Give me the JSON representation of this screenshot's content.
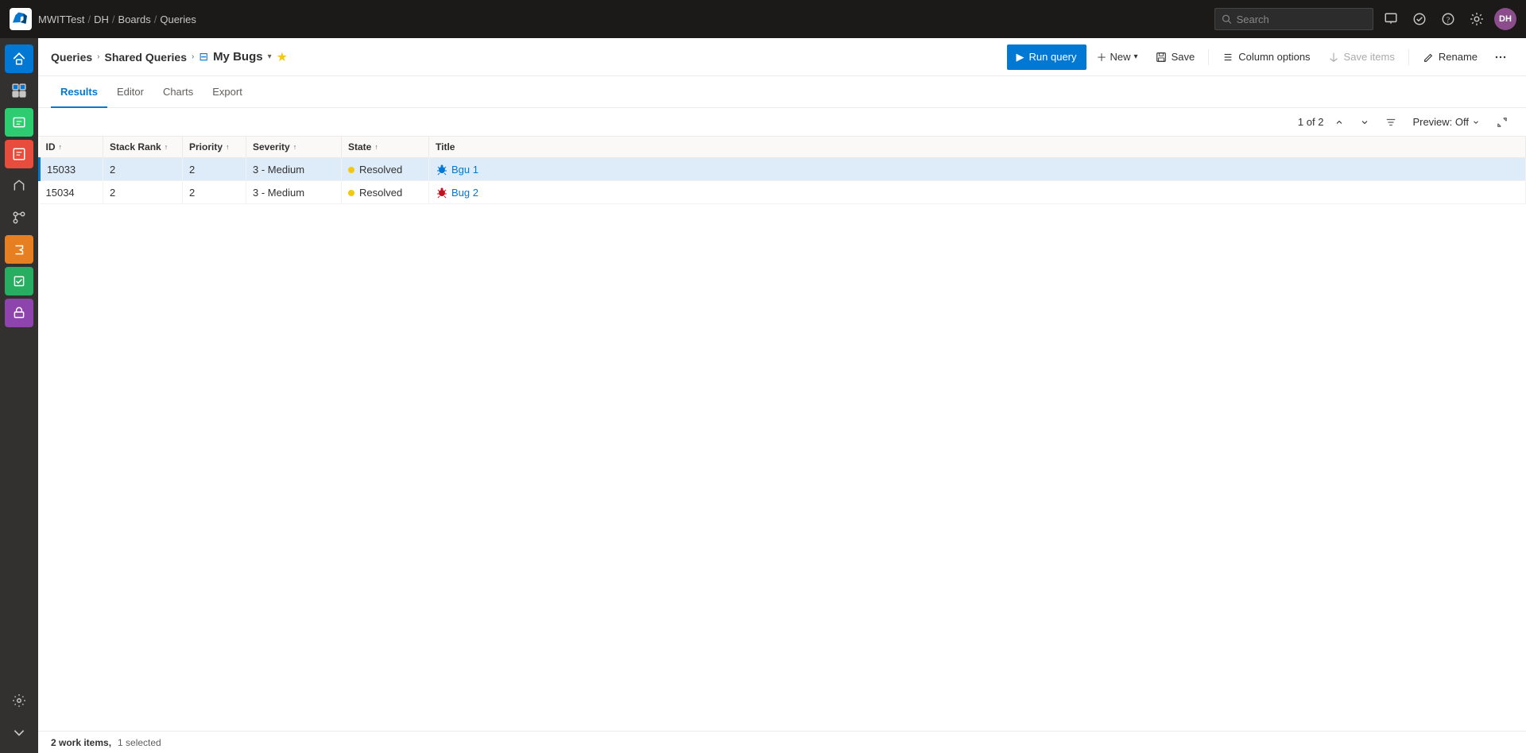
{
  "topbar": {
    "logo_label": "Azure DevOps",
    "breadcrumb": [
      "MWITTest",
      "DH",
      "Boards",
      "Queries"
    ],
    "search_placeholder": "Search"
  },
  "page": {
    "breadcrumb_queries": "Queries",
    "breadcrumb_shared": "Shared Queries",
    "query_title": "My Bugs",
    "run_query_label": "Run query",
    "new_label": "New",
    "save_label": "Save",
    "column_options_label": "Column options",
    "save_items_label": "Save items",
    "rename_label": "Rename"
  },
  "tabs": [
    {
      "label": "Results",
      "active": true
    },
    {
      "label": "Editor",
      "active": false
    },
    {
      "label": "Charts",
      "active": false
    },
    {
      "label": "Export",
      "active": false
    }
  ],
  "pagination": {
    "text": "1 of 2"
  },
  "preview": {
    "label": "Preview: Off"
  },
  "columns": [
    {
      "label": "ID",
      "sort": "↑"
    },
    {
      "label": "Stack Rank",
      "sort": "↑"
    },
    {
      "label": "Priority",
      "sort": "↑"
    },
    {
      "label": "Severity",
      "sort": "↑"
    },
    {
      "label": "State",
      "sort": "↑"
    },
    {
      "label": "Title",
      "sort": ""
    }
  ],
  "rows": [
    {
      "id": "15033",
      "stack_rank": "2",
      "priority": "2",
      "severity": "3 - Medium",
      "state": "Resolved",
      "title": "Bgu 1",
      "selected": true,
      "bug_color": "blue"
    },
    {
      "id": "15034",
      "stack_rank": "2",
      "priority": "2",
      "severity": "3 - Medium",
      "state": "Resolved",
      "title": "Bug 2",
      "selected": false,
      "bug_color": "red"
    }
  ],
  "statusbar": {
    "count_text": "2 work items,",
    "selected_text": "1 selected"
  },
  "sidebar": {
    "items": [
      {
        "name": "home",
        "symbol": "⌂",
        "active": true
      },
      {
        "name": "boards",
        "symbol": "⊞",
        "active": false
      },
      {
        "name": "work-items",
        "symbol": "📋",
        "active": false
      },
      {
        "name": "queries",
        "symbol": "🔍",
        "active": true
      },
      {
        "name": "sprints",
        "symbol": "⚡",
        "active": false
      },
      {
        "name": "repos",
        "symbol": "🗄",
        "active": false
      },
      {
        "name": "pipelines",
        "symbol": "►",
        "active": false
      },
      {
        "name": "test-plans",
        "symbol": "✓",
        "active": false
      },
      {
        "name": "artifacts",
        "symbol": "📦",
        "active": false
      }
    ]
  }
}
